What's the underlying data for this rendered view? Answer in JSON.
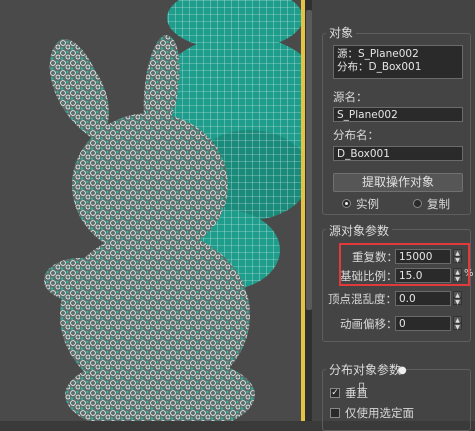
{
  "panel": {
    "object_group": {
      "title": "对象",
      "list_line1": "源：S_Plane002",
      "list_line2": "分布：D_Box001",
      "source_name_label": "源名：",
      "source_name_value": "S_Plane002",
      "dist_name_label": "分布名：",
      "dist_name_value": "D_Box001",
      "extract_button": "提取操作对象",
      "radio_instance": "实例",
      "radio_copy": "复制"
    },
    "source_params": {
      "title": "源对象参数",
      "duplicates_label": "重复数：",
      "duplicates_value": "15000",
      "base_scale_label": "基础比例：",
      "base_scale_value": "15.0",
      "base_scale_unit": "%",
      "vertex_chaos_label": "顶点混乱度：",
      "vertex_chaos_value": "0.0",
      "anim_offset_label": "动画偏移：",
      "anim_offset_value": "0"
    },
    "dist_params": {
      "title": "分布对象参数",
      "check_perpendicular": "垂直",
      "check_selected_only": "仅使用选定面"
    }
  },
  "colors": {
    "highlight_box": "#e23a3a",
    "viewport_border": "#e4c243",
    "teal_mesh": "#1f9d8c"
  }
}
